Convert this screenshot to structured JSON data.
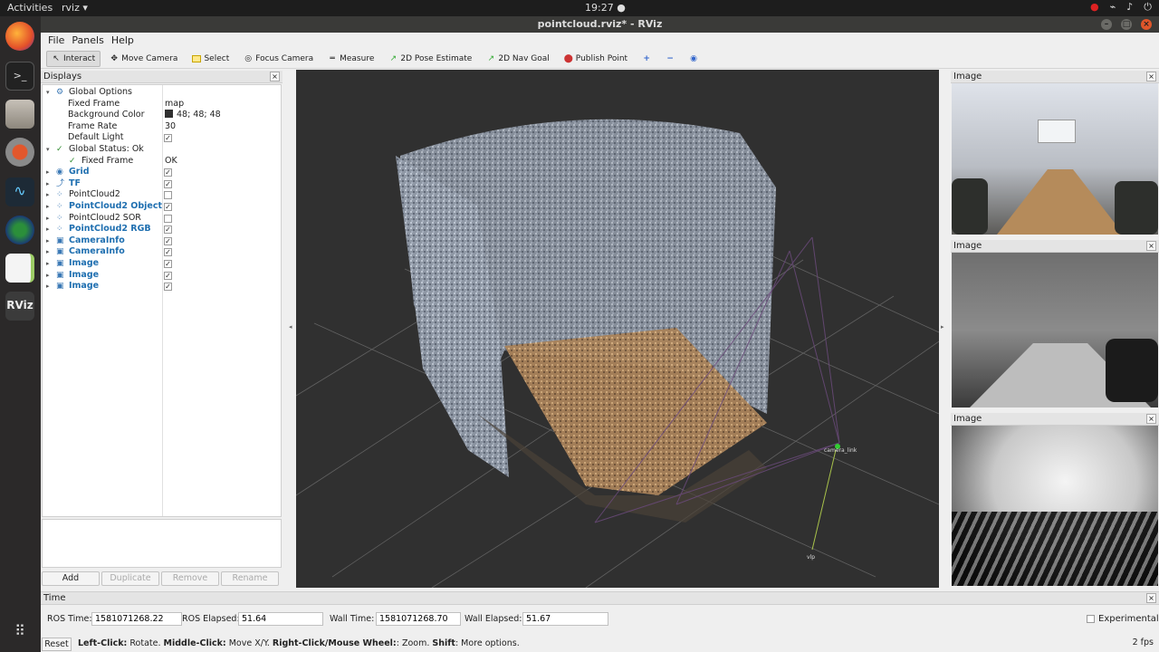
{
  "topbar": {
    "activities": "Activities",
    "app_name": "rviz ▾",
    "clock": "19:27 ●"
  },
  "window": {
    "title": "pointcloud.rviz* - RViz"
  },
  "menu": [
    "File",
    "Panels",
    "Help"
  ],
  "toolbar": {
    "tools": [
      {
        "label": "Interact",
        "icon": "↖",
        "active": true
      },
      {
        "label": "Move Camera",
        "icon": "✥"
      },
      {
        "label": "Select",
        "icon": "▭"
      },
      {
        "label": "Focus Camera",
        "icon": "◎"
      },
      {
        "label": "Measure",
        "icon": "═"
      },
      {
        "label": "2D Pose Estimate",
        "icon": "↗"
      },
      {
        "label": "2D Nav Goal",
        "icon": "↗"
      },
      {
        "label": "Publish Point",
        "icon": "📍"
      }
    ],
    "icons": [
      "plus-icon",
      "minus-icon",
      "eye-icon"
    ]
  },
  "displays": {
    "title": "Displays",
    "rows": [
      {
        "level": 0,
        "arrow": "▾",
        "icon": "⚙",
        "label": "Global Options",
        "value": ""
      },
      {
        "level": 1,
        "label": "Fixed Frame",
        "value": "map"
      },
      {
        "level": 1,
        "label": "Background Color",
        "value": "48; 48; 48",
        "swatch": "#303030"
      },
      {
        "level": 1,
        "label": "Frame Rate",
        "value": "30"
      },
      {
        "level": 1,
        "label": "Default Light",
        "check": true
      },
      {
        "level": 0,
        "arrow": "▾",
        "icon": "✓",
        "label": "Global Status: Ok",
        "value": ""
      },
      {
        "level": 1,
        "icon": "✓",
        "label": "Fixed Frame",
        "value": "OK"
      },
      {
        "level": 0,
        "arrow": "▸",
        "icon": "◉",
        "label": "Grid",
        "blue": true,
        "check": true
      },
      {
        "level": 0,
        "arrow": "▸",
        "icon": "⤴",
        "label": "TF",
        "blue": true,
        "check": true
      },
      {
        "level": 0,
        "arrow": "▸",
        "icon": "⁘",
        "label": "PointCloud2",
        "check": false
      },
      {
        "level": 0,
        "arrow": "▸",
        "icon": "⁘",
        "label": "PointCloud2 Object",
        "blue": true,
        "check": true
      },
      {
        "level": 0,
        "arrow": "▸",
        "icon": "⁘",
        "label": "PointCloud2 SOR",
        "check": false
      },
      {
        "level": 0,
        "arrow": "▸",
        "icon": "⁘",
        "label": "PointCloud2 RGB",
        "blue": true,
        "check": true
      },
      {
        "level": 0,
        "arrow": "▸",
        "icon": "▣",
        "label": "CameraInfo",
        "blue": true,
        "check": true
      },
      {
        "level": 0,
        "arrow": "▸",
        "icon": "▣",
        "label": "CameraInfo",
        "blue": true,
        "check": true
      },
      {
        "level": 0,
        "arrow": "▸",
        "icon": "▣",
        "label": "Image",
        "blue": true,
        "check": true
      },
      {
        "level": 0,
        "arrow": "▸",
        "icon": "▣",
        "label": "Image",
        "blue": true,
        "check": true
      },
      {
        "level": 0,
        "arrow": "▸",
        "icon": "▣",
        "label": "Image",
        "blue": true,
        "check": true
      }
    ],
    "buttons": [
      {
        "label": "Add",
        "disabled": false
      },
      {
        "label": "Duplicate",
        "disabled": true
      },
      {
        "label": "Remove",
        "disabled": true
      },
      {
        "label": "Rename",
        "disabled": true
      }
    ]
  },
  "images": [
    {
      "title": "Image"
    },
    {
      "title": "Image"
    },
    {
      "title": "Image"
    }
  ],
  "time": {
    "title": "Time",
    "ros_time_label": "ROS Time:",
    "ros_time": "1581071268.22",
    "ros_elapsed_label": "ROS Elapsed:",
    "ros_elapsed": "51.64",
    "wall_time_label": "Wall Time:",
    "wall_time": "1581071268.70",
    "wall_elapsed_label": "Wall Elapsed:",
    "wall_elapsed": "51.67",
    "experimental": "Experimental"
  },
  "status": {
    "reset": "Reset",
    "hint_parts": [
      {
        "t": "Left-Click:",
        "b": true
      },
      {
        "t": " Rotate. "
      },
      {
        "t": "Middle-Click:",
        "b": true
      },
      {
        "t": " Move X/Y. "
      },
      {
        "t": "Right-Click/Mouse Wheel:",
        "b": true
      },
      {
        "t": ": Zoom. "
      },
      {
        "t": "Shift",
        "b": true
      },
      {
        "t": ": More options."
      }
    ],
    "fps": "2 fps"
  },
  "scene": {
    "frame_label": "camera_link",
    "axis_label": "vlp"
  }
}
